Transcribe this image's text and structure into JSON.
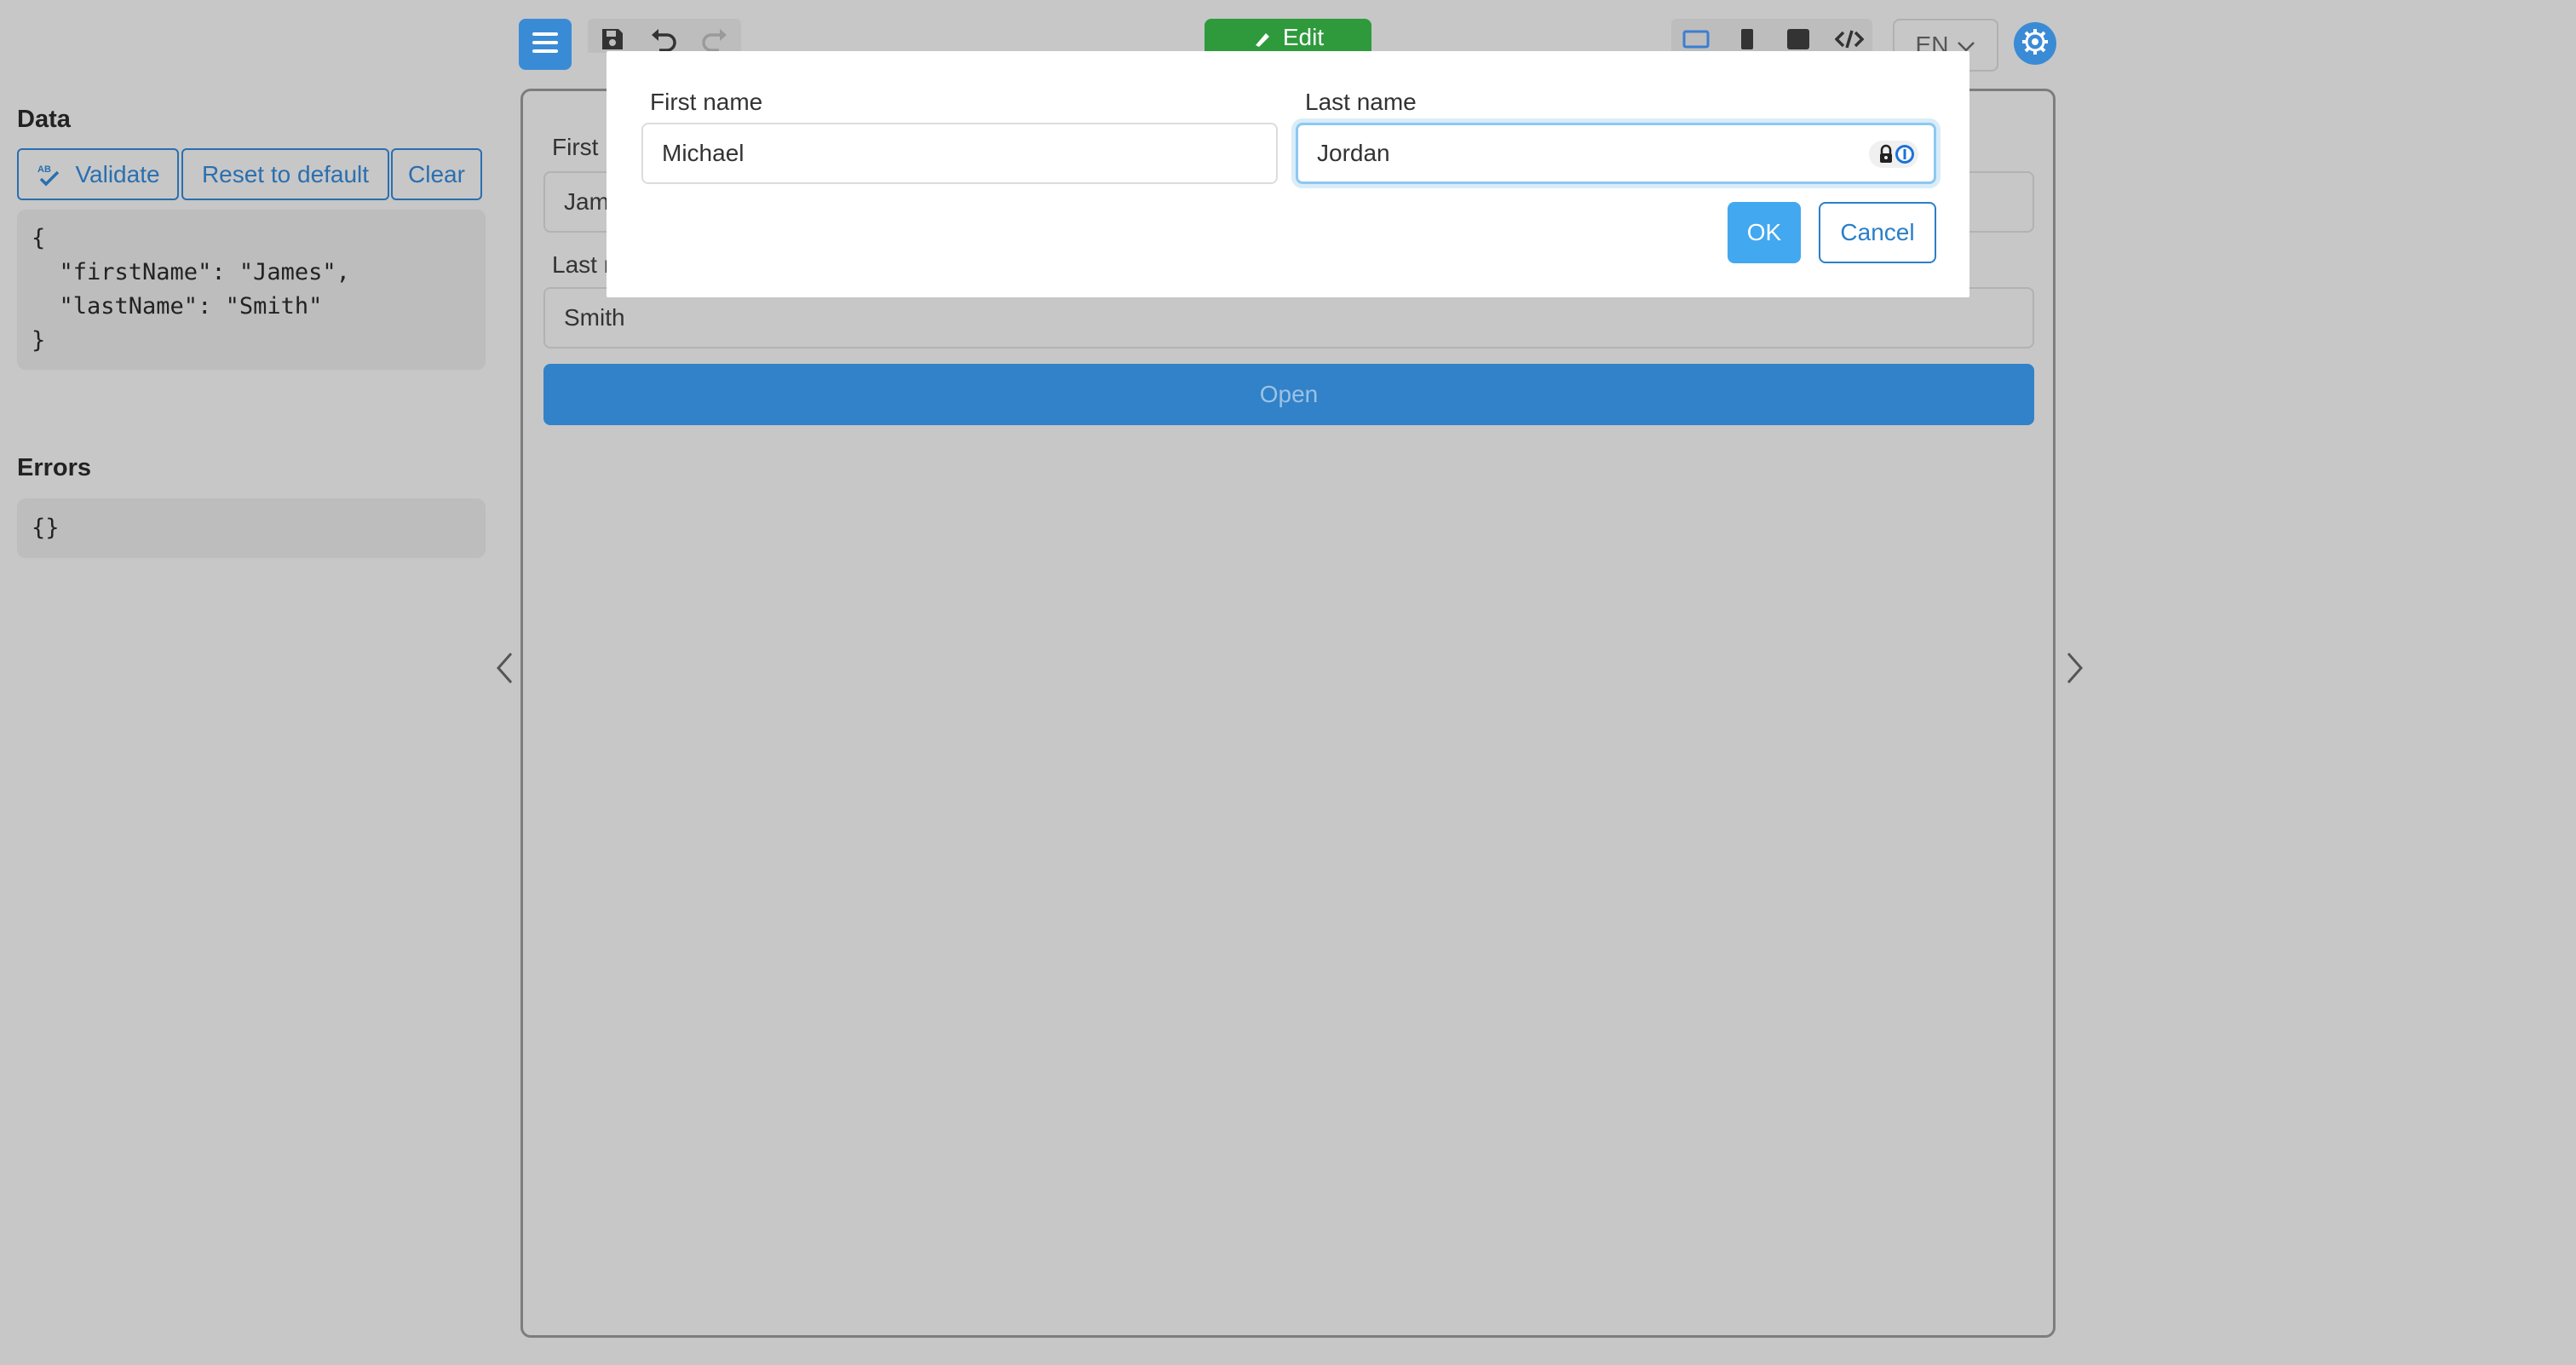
{
  "toolbar": {
    "menu_icon": "hamburger-menu-icon",
    "save_icon": "save-icon",
    "undo_icon": "undo-icon",
    "redo_icon": "redo-icon",
    "edit_label": "Edit",
    "edit_icon": "brush-icon",
    "layout_icons": [
      "desktop-icon",
      "phone-icon",
      "tablet-icon",
      "code-icon"
    ],
    "language": "EN",
    "settings_icon": "gear-icon"
  },
  "data_panel": {
    "title": "Data",
    "validate_label": "Validate",
    "reset_label": "Reset to default",
    "clear_label": "Clear",
    "json_lines": [
      "{",
      "  \"firstName\": \"James\",",
      "  \"lastName\": \"Smith\"",
      "}"
    ]
  },
  "errors_panel": {
    "title": "Errors",
    "value": "{}"
  },
  "preview": {
    "first_name_label": "First",
    "first_name_value": "Jam",
    "last_name_label": "Last r",
    "last_name_value": "Smith",
    "open_label": "Open"
  },
  "modal": {
    "first_name_label": "First name",
    "first_name_value": "Michael",
    "last_name_label": "Last name",
    "last_name_value": "Jordan",
    "ok_label": "OK",
    "cancel_label": "Cancel"
  },
  "colors": {
    "primary": "#3182c8",
    "edit_green": "#2e9a3c",
    "ok_blue": "#42a8f0",
    "link_blue": "#2a6fb0"
  }
}
